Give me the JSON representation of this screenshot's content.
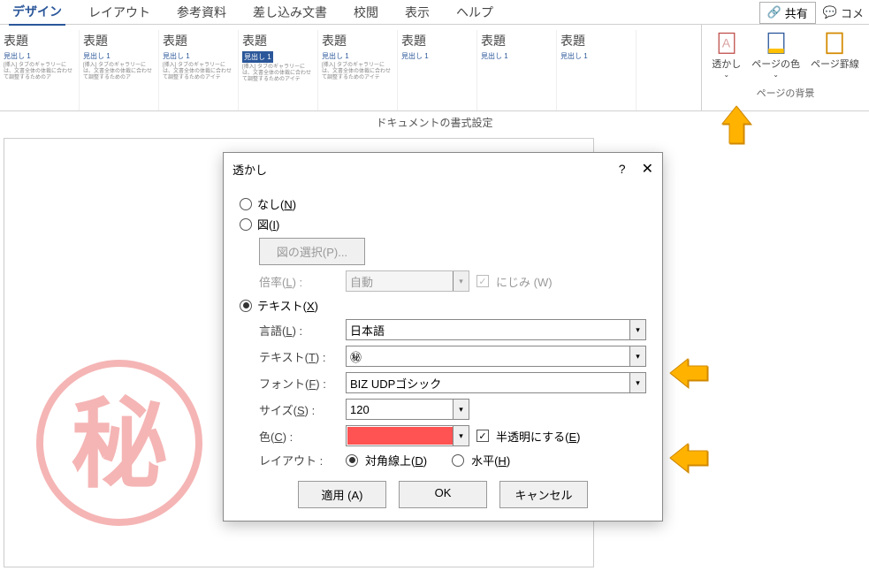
{
  "ribbon": {
    "tabs": [
      "デザイン",
      "レイアウト",
      "参考資料",
      "差し込み文書",
      "校閲",
      "表示",
      "ヘルプ"
    ],
    "activeTab": 0,
    "share": "共有",
    "comment": "コメ",
    "docFormatLabel": "ドキュメントの書式設定",
    "gallery": [
      {
        "title": "表題",
        "sub": "見出し 1",
        "desc": "[挿入] タブのギャラリーには、文書全体の体裁に合わせて調整するためのア"
      },
      {
        "title": "表題",
        "sub": "見出し 1",
        "desc": "[挿入] タブのギャラリーには、文書全体の体裁に合わせて調整するためのア"
      },
      {
        "title": "表題",
        "sub": "見出し 1",
        "desc": "[挿入] タブのギャラリーには、文書全体の体裁に合わせて調整するためのアイテ"
      },
      {
        "title": "表題",
        "sub": "見出し 1",
        "desc": "[挿入] タブのギャラリーには、文書全体の体裁に合わせて調整するためのアイテ"
      },
      {
        "title": "表題",
        "sub": "見出し 1",
        "desc": "[挿入] タブのギャラリーには、文書全体の体裁に合わせて調整するためのアイテ"
      },
      {
        "title": "表題",
        "sub": "見出し 1",
        "desc": ""
      },
      {
        "title": "表題",
        "sub": "見出し 1",
        "desc": ""
      },
      {
        "title": "表題",
        "sub": "見出し 1",
        "desc": ""
      }
    ],
    "right": {
      "watermark": "透かし",
      "pageColor": "ページの色",
      "pageBorder": "ページ罫線",
      "sectionLabel": "ページの背景"
    }
  },
  "dialog": {
    "title": "透かし",
    "help": "?",
    "options": {
      "none": "なし(N)",
      "picture": "図(I)",
      "pictureSelect": "図の選択(P)...",
      "scale": "倍率(L) :",
      "scaleValue": "自動",
      "washout": "にじみ (W)",
      "text": "テキスト(X)",
      "language": "言語(L) :",
      "languageValue": "日本語",
      "textLabel": "テキスト(T) :",
      "textValue": "㊙",
      "font": "フォント(F) :",
      "fontValue": "BIZ UDPゴシック",
      "size": "サイズ(S) :",
      "sizeValue": "120",
      "color": "色(C) :",
      "semitransparent": "半透明にする(E)",
      "layout": "レイアウト :",
      "diagonal": "対角線上(D)",
      "horizontal": "水平(H)"
    },
    "buttons": {
      "apply": "適用 (A)",
      "ok": "OK",
      "cancel": "キャンセル"
    }
  }
}
